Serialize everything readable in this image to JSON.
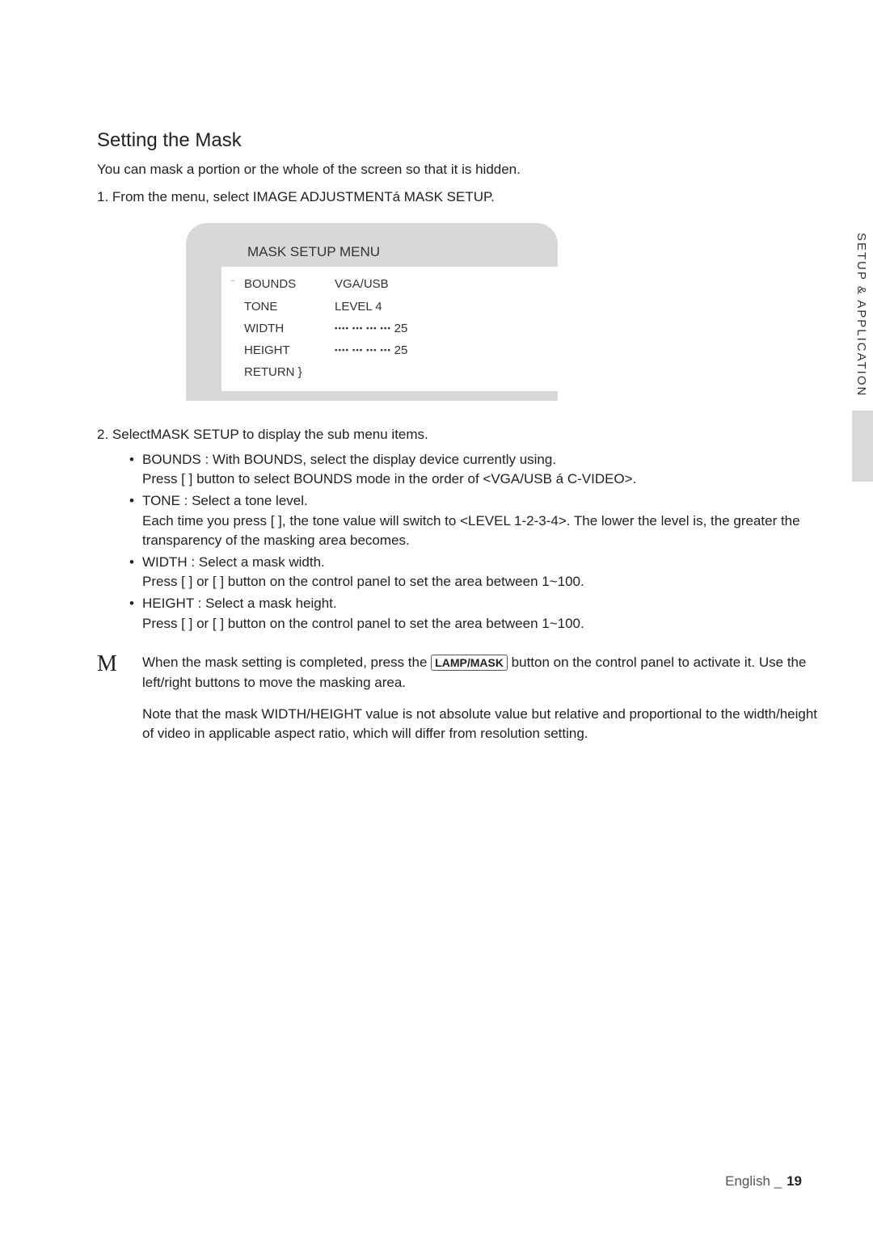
{
  "heading": "Setting the Mask",
  "intro": "You can mask a portion or the whole of the screen so that it is hidden.",
  "step1": "1.  From the menu, select IMAGE ADJUSTMENTá  MASK SETUP.",
  "menu": {
    "title": "MASK SETUP MENU",
    "caret": "¨",
    "rows": {
      "bounds_label": "BOUNDS",
      "bounds_value": "VGA/USB",
      "tone_label": "TONE",
      "tone_value": "LEVEL 4",
      "width_label": "WIDTH",
      "width_value_num": "25",
      "height_label": "HEIGHT",
      "height_value_num": "25",
      "return_label": "RETURN }"
    }
  },
  "step2_lead": "2.  SelectMASK SETUP to display the sub menu items.",
  "bullets": {
    "bounds_1": "BOUNDS : With BOUNDS, select the display device currently using.",
    "bounds_2": "Press [ ] button to select BOUNDS mode in the order of <VGA/USB á  C-VIDEO>.",
    "tone_1": "TONE : Select a tone level.",
    "tone_2": "Each time you press [ ], the tone value will switch to <LEVEL 1-2-3-4>. The lower the level is, the greater the transparency of the masking area becomes.",
    "width_1": "WIDTH : Select a mask width.",
    "width_2": "Press [   ] or [   ] button on the control panel to set the area between 1~100.",
    "height_1": "HEIGHT : Select a mask height.",
    "height_2": "Press [   ] or [   ] button on the control panel to set the area between 1~100."
  },
  "note": {
    "m": "M",
    "line1_a": "When the mask setting is completed, press the ",
    "line1_btn": "LAMP/MASK",
    "line1_b": " button on the control panel to activate it. Use the left/right buttons to move the masking area.",
    "line2": "Note that the mask WIDTH/HEIGHT value is not absolute value but relative and proportional to the width/height of video in applicable aspect ratio, which will differ from resolution setting."
  },
  "side_tab": "SETUP & APPLICATION",
  "footer_lang": "English _",
  "footer_page": "19"
}
